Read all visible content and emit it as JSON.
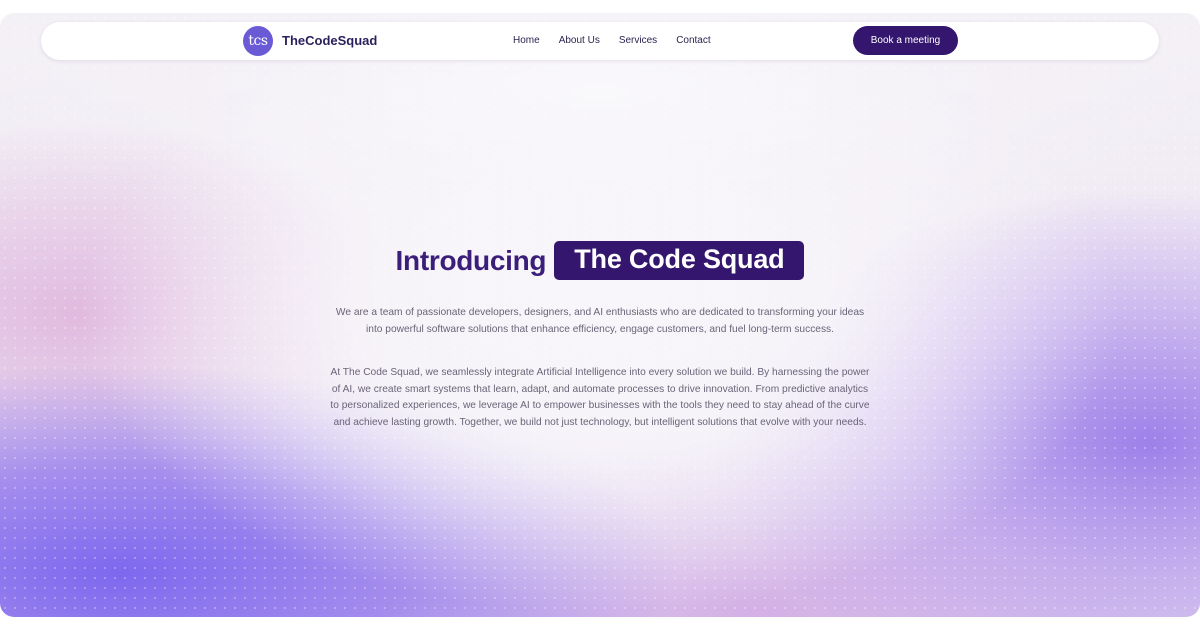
{
  "navbar": {
    "logo_mark": "tcs",
    "brand_name": "TheCodeSquad",
    "links": [
      "Home",
      "About Us",
      "Services",
      "Contact"
    ],
    "cta_label": "Book a meeting"
  },
  "hero": {
    "headline_lead": "Introducing",
    "headline_highlight": "The Code Squad",
    "intro_text": "We are a team of passionate developers, designers, and AI enthusiasts who are dedicated to transforming your ideas into powerful software solutions that enhance efficiency, engage customers, and fuel long-term success.",
    "detail_text": "At The Code Squad, we seamlessly integrate Artificial Intelligence into every solution we build. By harnessing the power of AI, we create smart systems that learn, adapt, and automate processes to drive innovation. From predictive analytics to personalized experiences, we leverage AI to empower businesses with the tools they need to stay ahead of the curve and achieve lasting growth. Together, we build not just technology, but intelligent solutions that evolve with your needs."
  },
  "colors": {
    "brand_dark": "#34166e",
    "logo_purple": "#6b5ad6",
    "gradient_purple": "#7862ee",
    "gradient_pink": "#deb2dc"
  }
}
